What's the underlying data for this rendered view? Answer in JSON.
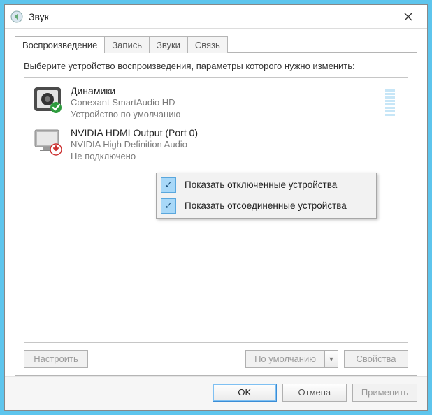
{
  "window": {
    "title": "Звук"
  },
  "tabs": [
    {
      "label": "Воспроизведение",
      "active": true
    },
    {
      "label": "Запись",
      "active": false
    },
    {
      "label": "Звуки",
      "active": false
    },
    {
      "label": "Связь",
      "active": false
    }
  ],
  "instructions": "Выберите устройство воспроизведения, параметры которого нужно изменить:",
  "devices": [
    {
      "name": "Динамики",
      "description": "Conexant SmartAudio HD",
      "status": "Устройство по умолчанию",
      "badge": "default",
      "icon": "speaker"
    },
    {
      "name": "NVIDIA HDMI Output (Port 0)",
      "description": "NVIDIA High Definition Audio",
      "status": "Не подключено",
      "badge": "disconnected",
      "icon": "monitor"
    }
  ],
  "context_menu": [
    {
      "label": "Показать отключенные устройства",
      "checked": true
    },
    {
      "label": "Показать отсоединенные устройства",
      "checked": true
    }
  ],
  "panel_buttons": {
    "configure": "Настроить",
    "set_default": "По умолчанию",
    "properties": "Свойства"
  },
  "dialog_buttons": {
    "ok": "OK",
    "cancel": "Отмена",
    "apply": "Применить"
  }
}
